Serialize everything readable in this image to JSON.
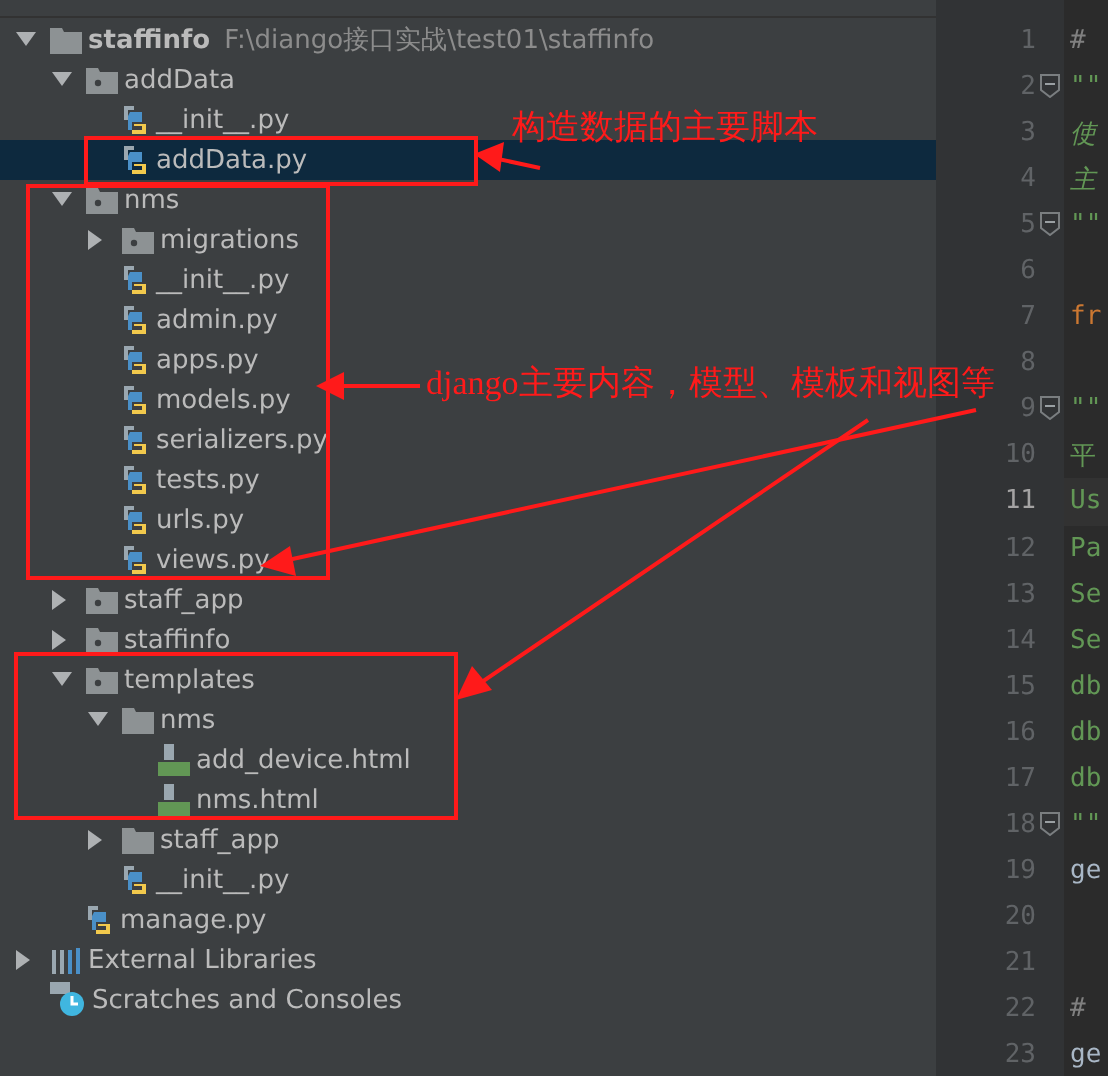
{
  "tree": [
    {
      "label": "staffinfo",
      "path": "F:\\diango接口实战\\test01\\staffinfo",
      "kind": "folder",
      "expanded": true,
      "selected": false,
      "children": [
        {
          "label": "addData",
          "kind": "package",
          "expanded": true,
          "selected": false,
          "children": [
            {
              "label": "__init__.py",
              "kind": "python",
              "selected": false
            },
            {
              "label": "addData.py",
              "kind": "python",
              "selected": true
            }
          ]
        },
        {
          "label": "nms",
          "kind": "package",
          "expanded": true,
          "selected": false,
          "children": [
            {
              "label": "migrations",
              "kind": "package",
              "expanded": false,
              "selected": false
            },
            {
              "label": "__init__.py",
              "kind": "python",
              "selected": false
            },
            {
              "label": "admin.py",
              "kind": "python",
              "selected": false
            },
            {
              "label": "apps.py",
              "kind": "python",
              "selected": false
            },
            {
              "label": "models.py",
              "kind": "python",
              "selected": false
            },
            {
              "label": "serializers.py",
              "kind": "python",
              "selected": false
            },
            {
              "label": "tests.py",
              "kind": "python",
              "selected": false
            },
            {
              "label": "urls.py",
              "kind": "python",
              "selected": false
            },
            {
              "label": "views.py",
              "kind": "python",
              "selected": false
            }
          ]
        },
        {
          "label": "staff_app",
          "kind": "package",
          "expanded": false,
          "selected": false
        },
        {
          "label": "staffinfo",
          "kind": "package",
          "expanded": false,
          "selected": false
        },
        {
          "label": "templates",
          "kind": "package",
          "expanded": true,
          "selected": false,
          "children": [
            {
              "label": "nms",
              "kind": "folder",
              "expanded": true,
              "selected": false,
              "children": [
                {
                  "label": "add_device.html",
                  "kind": "html",
                  "selected": false
                },
                {
                  "label": "nms.html",
                  "kind": "html",
                  "selected": false
                }
              ]
            },
            {
              "label": "staff_app",
              "kind": "folder",
              "expanded": false,
              "selected": false
            },
            {
              "label": "__init__.py",
              "kind": "python",
              "selected": false
            }
          ]
        },
        {
          "label": "manage.py",
          "kind": "python",
          "selected": false
        }
      ]
    },
    {
      "label": "External Libraries",
      "kind": "libraries",
      "expanded": false,
      "selected": false
    },
    {
      "label": "Scratches and Consoles",
      "kind": "scratches",
      "selected": false
    }
  ],
  "editor": {
    "lines": [
      {
        "number": "1",
        "text": "#",
        "kind": "comment",
        "fold": false
      },
      {
        "number": "2",
        "text": "\"\"",
        "kind": "doc",
        "fold": true
      },
      {
        "number": "3",
        "text": "使",
        "kind": "doc",
        "fold": false
      },
      {
        "number": "4",
        "text": "主",
        "kind": "doc",
        "fold": false
      },
      {
        "number": "5",
        "text": "\"\"",
        "kind": "doc",
        "fold": true
      },
      {
        "number": "6",
        "fold": false
      },
      {
        "number": "7",
        "text": "fr",
        "kind": "keyword",
        "fold": false
      },
      {
        "number": "8",
        "fold": false
      },
      {
        "number": "9",
        "text": "\"\"",
        "kind": "doc",
        "fold": true
      },
      {
        "number": "10",
        "text": "平",
        "kind": "doc",
        "fold": false
      },
      {
        "number": "11",
        "text": "Us",
        "kind": "doc",
        "fold": false,
        "current": true
      },
      {
        "number": "12",
        "text": "Pa",
        "kind": "doc",
        "fold": false
      },
      {
        "number": "13",
        "text": "Se",
        "kind": "doc",
        "fold": false
      },
      {
        "number": "14",
        "text": "Se",
        "kind": "doc",
        "fold": false
      },
      {
        "number": "15",
        "text": "db",
        "kind": "doc",
        "fold": false
      },
      {
        "number": "16",
        "text": "db",
        "kind": "doc",
        "fold": false
      },
      {
        "number": "17",
        "text": "db",
        "kind": "doc",
        "fold": false
      },
      {
        "number": "18",
        "text": "\"\"",
        "kind": "doc",
        "fold": true
      },
      {
        "number": "19",
        "text": "ge",
        "kind": "plain",
        "fold": false
      },
      {
        "number": "20",
        "fold": false
      },
      {
        "number": "21",
        "fold": false
      },
      {
        "number": "22",
        "text": "#",
        "kind": "comment",
        "fold": false
      },
      {
        "number": "23",
        "text": "ge",
        "kind": "plain",
        "fold": false
      }
    ]
  },
  "annotations": [
    {
      "text": "构造数据的主要脚本"
    },
    {
      "text": "django主要内容，模型、模板和视图等"
    }
  ]
}
